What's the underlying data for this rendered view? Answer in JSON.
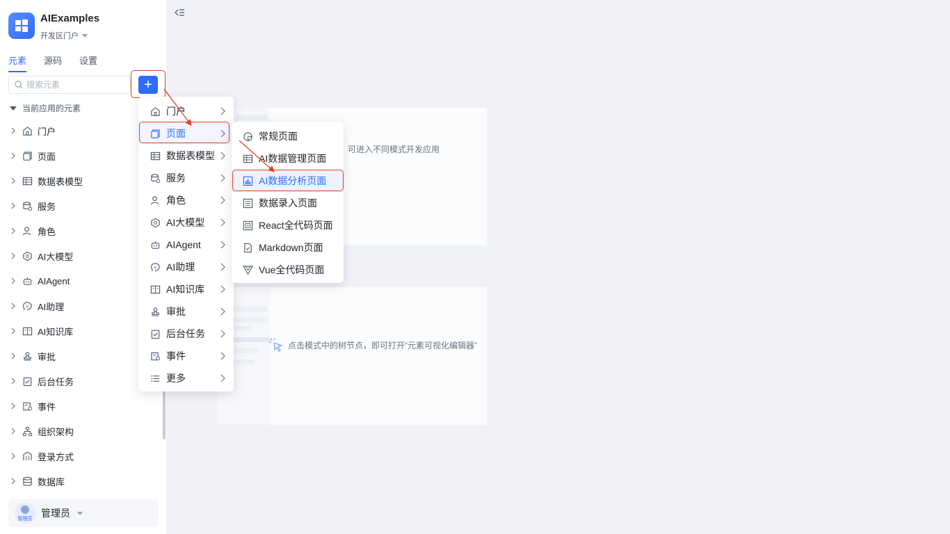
{
  "app": {
    "name": "AIExamples",
    "env": "开发区门户"
  },
  "tabs": [
    {
      "label": "元素",
      "active": true
    },
    {
      "label": "源码",
      "active": false
    },
    {
      "label": "设置",
      "active": false
    }
  ],
  "search": {
    "placeholder": "搜索元素",
    "value": ""
  },
  "add_button": {
    "label": "+"
  },
  "group": {
    "title": "当前应用的元素"
  },
  "tree": [
    {
      "label": "门户",
      "icon": "home-icon"
    },
    {
      "label": "页面",
      "icon": "page-icon"
    },
    {
      "label": "数据表模型",
      "icon": "table-icon"
    },
    {
      "label": "服务",
      "icon": "service-icon"
    },
    {
      "label": "角色",
      "icon": "role-icon"
    },
    {
      "label": "AI大模型",
      "icon": "model-icon"
    },
    {
      "label": "AIAgent",
      "icon": "robot-icon"
    },
    {
      "label": "AI助理",
      "icon": "assistant-icon"
    },
    {
      "label": "AI知识库",
      "icon": "knowledge-icon"
    },
    {
      "label": "审批",
      "icon": "stamp-icon"
    },
    {
      "label": "后台任务",
      "icon": "task-icon"
    },
    {
      "label": "事件",
      "icon": "event-icon"
    },
    {
      "label": "组织架构",
      "icon": "org-icon"
    },
    {
      "label": "登录方式",
      "icon": "login-icon"
    },
    {
      "label": "数据库",
      "icon": "database-icon"
    }
  ],
  "user": {
    "name": "管理员",
    "avatar_label": "管理员"
  },
  "main": {
    "hint_top": "航，可进入不同模式开发应用",
    "hint_bottom": "点击模式中的树节点，即可打开“元素可视化编辑器”"
  },
  "add_menu": [
    {
      "label": "门户",
      "icon": "home-icon",
      "selected": false
    },
    {
      "label": "页面",
      "icon": "page-icon",
      "selected": true
    },
    {
      "label": "数据表模型",
      "icon": "table-icon",
      "selected": false
    },
    {
      "label": "服务",
      "icon": "service-icon",
      "selected": false
    },
    {
      "label": "角色",
      "icon": "role-icon",
      "selected": false
    },
    {
      "label": "AI大模型",
      "icon": "model-icon",
      "selected": false
    },
    {
      "label": "AIAgent",
      "icon": "robot-icon",
      "selected": false
    },
    {
      "label": "AI助理",
      "icon": "assistant-icon",
      "selected": false
    },
    {
      "label": "AI知识库",
      "icon": "knowledge-icon",
      "selected": false
    },
    {
      "label": "审批",
      "icon": "stamp-icon",
      "selected": false
    },
    {
      "label": "后台任务",
      "icon": "task-icon",
      "selected": false
    },
    {
      "label": "事件",
      "icon": "event-icon",
      "selected": false
    },
    {
      "label": "更多",
      "icon": "list-icon",
      "selected": false
    }
  ],
  "page_submenu": [
    {
      "label": "常规页面",
      "icon": "regular-page-icon",
      "selected": false
    },
    {
      "label": "AI数据管理页面",
      "icon": "data-grid-icon",
      "selected": false
    },
    {
      "label": "AI数据分析页面",
      "icon": "bar-chart-icon",
      "selected": true
    },
    {
      "label": "数据录入页面",
      "icon": "form-icon",
      "selected": false
    },
    {
      "label": "React全代码页面",
      "icon": "react-code-icon",
      "selected": false
    },
    {
      "label": "Markdown页面",
      "icon": "markdown-icon",
      "selected": false
    },
    {
      "label": "Vue全代码页面",
      "icon": "vue-icon",
      "selected": false
    }
  ],
  "colors": {
    "accent": "#2f6bff",
    "highlight": "#e0431f",
    "background": "#f0f2f8"
  }
}
